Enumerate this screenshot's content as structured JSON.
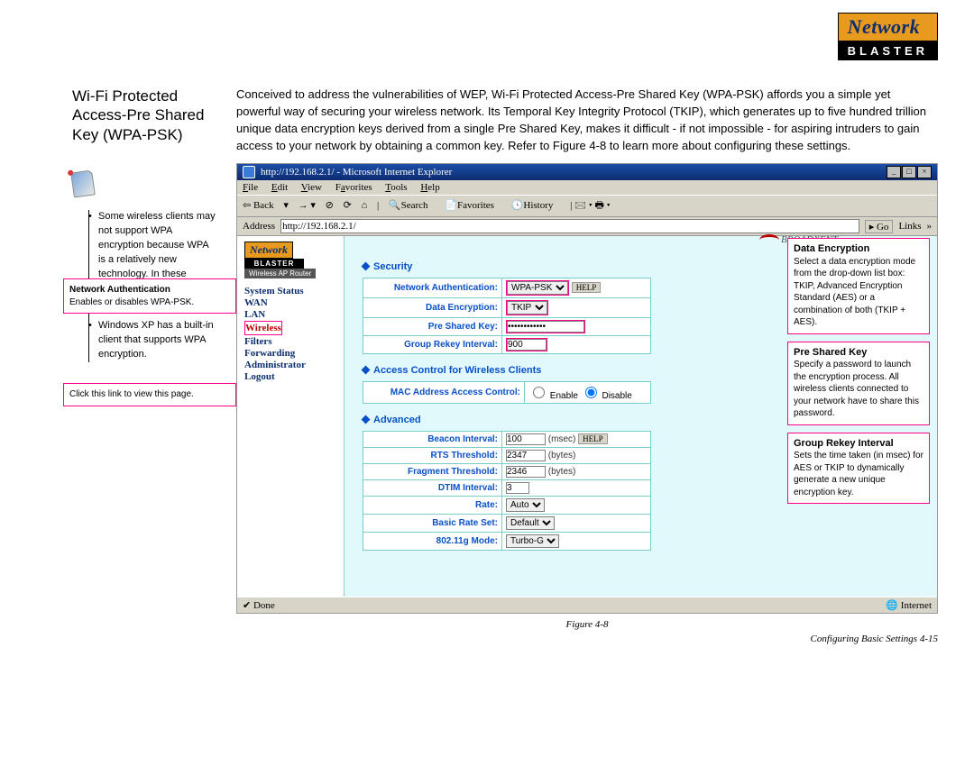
{
  "logo": {
    "top_word": "Network",
    "bottom_word": "BLASTER"
  },
  "heading": "Wi-Fi Protected Access-Pre Shared Key (WPA-PSK)",
  "tips": [
    "Some wireless clients may not support WPA encryption because WPA is a relatively new technology. In these cases, use WEP encryption instead.",
    "Windows XP has a built-in client that supports WPA encryption."
  ],
  "intro": "Conceived to address the vulnerabilities of WEP, Wi-Fi Protected Access-Pre Shared Key (WPA-PSK) affords you a simple yet powerful way of securing your wireless network. Its Temporal Key Integrity Protocol (TKIP), which generates up to five hundred trillion unique data encryption keys derived from a single Pre Shared Key, makes it difficult - if not impossible - for aspiring intruders to gain access to your network by obtaining a common key. Refer to Figure 4-8 to learn more about configuring these settings.",
  "browser": {
    "title": "http://192.168.2.1/ - Microsoft Internet Explorer",
    "menu": [
      "File",
      "Edit",
      "View",
      "Favorites",
      "Tools",
      "Help"
    ],
    "toolbar": {
      "back": "Back",
      "search": "Search",
      "favorites": "Favorites",
      "history": "History"
    },
    "address_label": "Address",
    "address": "http://192.168.2.1/",
    "go": "Go",
    "links": "Links",
    "status_done": "Done",
    "status_zone": "Internet"
  },
  "nav": {
    "mini_logo": {
      "n": "Network",
      "b": "BLASTER",
      "w": "Wireless AP Router"
    },
    "items": [
      "System Status",
      "WAN",
      "LAN",
      "Wireless",
      "Filters",
      "Forwarding",
      "Administrator",
      "Logout"
    ],
    "brand": "BROADXENT"
  },
  "callout_net_auth": {
    "title": "Network Authentication",
    "body": "Enables or disables WPA-PSK."
  },
  "callout_click": "Click this link to view this page.",
  "callout_data_enc": {
    "title": "Data Encryption",
    "body": "Select a data encryption mode from the drop-down list box: TKIP, Advanced Encryption Standard (AES) or a combination of both (TKIP + AES)."
  },
  "callout_psk": {
    "title": "Pre Shared Key",
    "body": "Specify a password to launch the encryption process. All wireless clients connected to your network have to share this password."
  },
  "callout_rekey": {
    "title": "Group Rekey Interval",
    "body": "Sets the time taken (in msec) for AES or TKIP to dynamically generate a new unique encryption key."
  },
  "sections": {
    "security": "Security",
    "acl": "Access Control for Wireless Clients",
    "advanced": "Advanced"
  },
  "security_rows": {
    "net_auth": {
      "label": "Network Authentication:",
      "value": "WPA-PSK",
      "help": "HELP"
    },
    "data_enc": {
      "label": "Data Encryption:",
      "value": "TKIP"
    },
    "psk": {
      "label": "Pre Shared Key:",
      "value": "************"
    },
    "rekey": {
      "label": "Group Rekey Interval:",
      "value": "900"
    }
  },
  "acl_row": {
    "label": "MAC Address Access Control:",
    "enable": "Enable",
    "disable": "Disable"
  },
  "adv": {
    "beacon": {
      "label": "Beacon Interval:",
      "value": "100",
      "unit": "(msec)",
      "help": "HELP"
    },
    "rts": {
      "label": "RTS Threshold:",
      "value": "2347",
      "unit": "(bytes)"
    },
    "frag": {
      "label": "Fragment Threshold:",
      "value": "2346",
      "unit": "(bytes)"
    },
    "dtim": {
      "label": "DTIM Interval:",
      "value": "3"
    },
    "rate": {
      "label": "Rate:",
      "value": "Auto"
    },
    "brs": {
      "label": "Basic Rate Set:",
      "value": "Default"
    },
    "mode": {
      "label": "802.11g Mode:",
      "value": "Turbo-G"
    }
  },
  "figure_caption": "Figure 4-8",
  "footer": "Configuring Basic Settings  4-15"
}
